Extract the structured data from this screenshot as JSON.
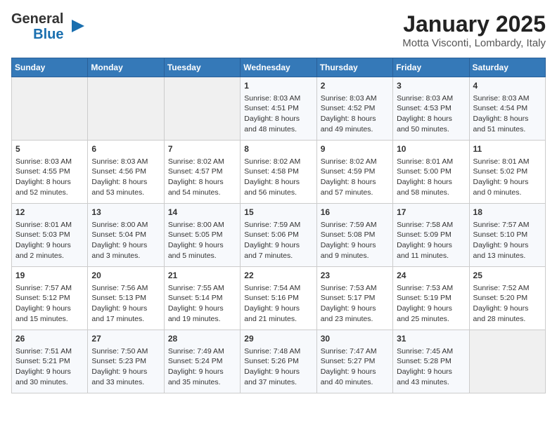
{
  "logo": {
    "general": "General",
    "blue": "Blue"
  },
  "title": "January 2025",
  "subtitle": "Motta Visconti, Lombardy, Italy",
  "days_of_week": [
    "Sunday",
    "Monday",
    "Tuesday",
    "Wednesday",
    "Thursday",
    "Friday",
    "Saturday"
  ],
  "weeks": [
    [
      {
        "day": "",
        "sunrise": "",
        "sunset": "",
        "daylight": "",
        "empty": true
      },
      {
        "day": "",
        "sunrise": "",
        "sunset": "",
        "daylight": "",
        "empty": true
      },
      {
        "day": "",
        "sunrise": "",
        "sunset": "",
        "daylight": "",
        "empty": true
      },
      {
        "day": "1",
        "sunrise": "Sunrise: 8:03 AM",
        "sunset": "Sunset: 4:51 PM",
        "daylight": "Daylight: 8 hours and 48 minutes."
      },
      {
        "day": "2",
        "sunrise": "Sunrise: 8:03 AM",
        "sunset": "Sunset: 4:52 PM",
        "daylight": "Daylight: 8 hours and 49 minutes."
      },
      {
        "day": "3",
        "sunrise": "Sunrise: 8:03 AM",
        "sunset": "Sunset: 4:53 PM",
        "daylight": "Daylight: 8 hours and 50 minutes."
      },
      {
        "day": "4",
        "sunrise": "Sunrise: 8:03 AM",
        "sunset": "Sunset: 4:54 PM",
        "daylight": "Daylight: 8 hours and 51 minutes."
      }
    ],
    [
      {
        "day": "5",
        "sunrise": "Sunrise: 8:03 AM",
        "sunset": "Sunset: 4:55 PM",
        "daylight": "Daylight: 8 hours and 52 minutes."
      },
      {
        "day": "6",
        "sunrise": "Sunrise: 8:03 AM",
        "sunset": "Sunset: 4:56 PM",
        "daylight": "Daylight: 8 hours and 53 minutes."
      },
      {
        "day": "7",
        "sunrise": "Sunrise: 8:02 AM",
        "sunset": "Sunset: 4:57 PM",
        "daylight": "Daylight: 8 hours and 54 minutes."
      },
      {
        "day": "8",
        "sunrise": "Sunrise: 8:02 AM",
        "sunset": "Sunset: 4:58 PM",
        "daylight": "Daylight: 8 hours and 56 minutes."
      },
      {
        "day": "9",
        "sunrise": "Sunrise: 8:02 AM",
        "sunset": "Sunset: 4:59 PM",
        "daylight": "Daylight: 8 hours and 57 minutes."
      },
      {
        "day": "10",
        "sunrise": "Sunrise: 8:01 AM",
        "sunset": "Sunset: 5:00 PM",
        "daylight": "Daylight: 8 hours and 58 minutes."
      },
      {
        "day": "11",
        "sunrise": "Sunrise: 8:01 AM",
        "sunset": "Sunset: 5:02 PM",
        "daylight": "Daylight: 9 hours and 0 minutes."
      }
    ],
    [
      {
        "day": "12",
        "sunrise": "Sunrise: 8:01 AM",
        "sunset": "Sunset: 5:03 PM",
        "daylight": "Daylight: 9 hours and 2 minutes."
      },
      {
        "day": "13",
        "sunrise": "Sunrise: 8:00 AM",
        "sunset": "Sunset: 5:04 PM",
        "daylight": "Daylight: 9 hours and 3 minutes."
      },
      {
        "day": "14",
        "sunrise": "Sunrise: 8:00 AM",
        "sunset": "Sunset: 5:05 PM",
        "daylight": "Daylight: 9 hours and 5 minutes."
      },
      {
        "day": "15",
        "sunrise": "Sunrise: 7:59 AM",
        "sunset": "Sunset: 5:06 PM",
        "daylight": "Daylight: 9 hours and 7 minutes."
      },
      {
        "day": "16",
        "sunrise": "Sunrise: 7:59 AM",
        "sunset": "Sunset: 5:08 PM",
        "daylight": "Daylight: 9 hours and 9 minutes."
      },
      {
        "day": "17",
        "sunrise": "Sunrise: 7:58 AM",
        "sunset": "Sunset: 5:09 PM",
        "daylight": "Daylight: 9 hours and 11 minutes."
      },
      {
        "day": "18",
        "sunrise": "Sunrise: 7:57 AM",
        "sunset": "Sunset: 5:10 PM",
        "daylight": "Daylight: 9 hours and 13 minutes."
      }
    ],
    [
      {
        "day": "19",
        "sunrise": "Sunrise: 7:57 AM",
        "sunset": "Sunset: 5:12 PM",
        "daylight": "Daylight: 9 hours and 15 minutes."
      },
      {
        "day": "20",
        "sunrise": "Sunrise: 7:56 AM",
        "sunset": "Sunset: 5:13 PM",
        "daylight": "Daylight: 9 hours and 17 minutes."
      },
      {
        "day": "21",
        "sunrise": "Sunrise: 7:55 AM",
        "sunset": "Sunset: 5:14 PM",
        "daylight": "Daylight: 9 hours and 19 minutes."
      },
      {
        "day": "22",
        "sunrise": "Sunrise: 7:54 AM",
        "sunset": "Sunset: 5:16 PM",
        "daylight": "Daylight: 9 hours and 21 minutes."
      },
      {
        "day": "23",
        "sunrise": "Sunrise: 7:53 AM",
        "sunset": "Sunset: 5:17 PM",
        "daylight": "Daylight: 9 hours and 23 minutes."
      },
      {
        "day": "24",
        "sunrise": "Sunrise: 7:53 AM",
        "sunset": "Sunset: 5:19 PM",
        "daylight": "Daylight: 9 hours and 25 minutes."
      },
      {
        "day": "25",
        "sunrise": "Sunrise: 7:52 AM",
        "sunset": "Sunset: 5:20 PM",
        "daylight": "Daylight: 9 hours and 28 minutes."
      }
    ],
    [
      {
        "day": "26",
        "sunrise": "Sunrise: 7:51 AM",
        "sunset": "Sunset: 5:21 PM",
        "daylight": "Daylight: 9 hours and 30 minutes."
      },
      {
        "day": "27",
        "sunrise": "Sunrise: 7:50 AM",
        "sunset": "Sunset: 5:23 PM",
        "daylight": "Daylight: 9 hours and 33 minutes."
      },
      {
        "day": "28",
        "sunrise": "Sunrise: 7:49 AM",
        "sunset": "Sunset: 5:24 PM",
        "daylight": "Daylight: 9 hours and 35 minutes."
      },
      {
        "day": "29",
        "sunrise": "Sunrise: 7:48 AM",
        "sunset": "Sunset: 5:26 PM",
        "daylight": "Daylight: 9 hours and 37 minutes."
      },
      {
        "day": "30",
        "sunrise": "Sunrise: 7:47 AM",
        "sunset": "Sunset: 5:27 PM",
        "daylight": "Daylight: 9 hours and 40 minutes."
      },
      {
        "day": "31",
        "sunrise": "Sunrise: 7:45 AM",
        "sunset": "Sunset: 5:28 PM",
        "daylight": "Daylight: 9 hours and 43 minutes."
      },
      {
        "day": "",
        "sunrise": "",
        "sunset": "",
        "daylight": "",
        "empty": true
      }
    ]
  ]
}
